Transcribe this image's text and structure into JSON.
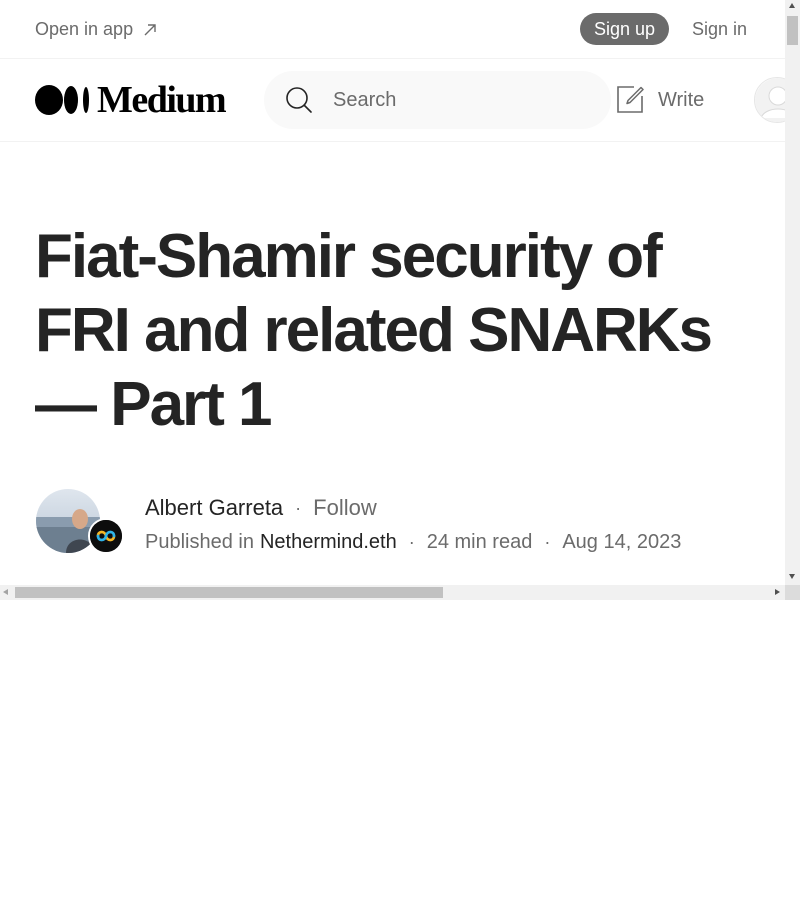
{
  "topbar": {
    "open_in_app": "Open in app",
    "sign_up": "Sign up",
    "sign_in": "Sign in"
  },
  "header": {
    "logo_text": "Medium",
    "search_placeholder": "Search",
    "write_label": "Write"
  },
  "article": {
    "title": "Fiat-Shamir security of FRI and related SNARKs — Part 1",
    "author_name": "Albert Garreta",
    "follow_label": "Follow",
    "published_in_label": "Published in",
    "publication": "Nethermind.eth",
    "read_time": "24 min read",
    "date": "Aug 14, 2023",
    "separator": "·"
  },
  "icons": {
    "open_in_app": "arrow-up-right-icon",
    "search": "search-icon",
    "write": "write-icon",
    "avatar": "user-avatar-icon"
  },
  "colors": {
    "text_primary": "#242424",
    "text_secondary": "#6b6b6b",
    "signup_bg": "#6b6b6b",
    "search_bg": "#f9f9f9"
  }
}
